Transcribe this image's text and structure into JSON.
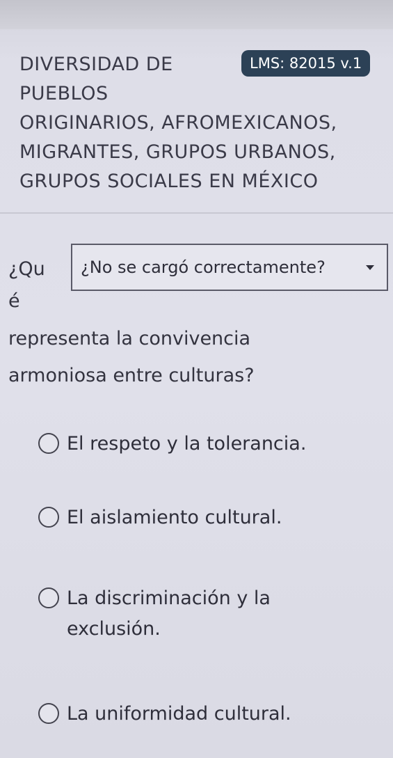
{
  "header": {
    "title": "DIVERSIDAD DE\nPUEBLOS\nORIGINARIOS, AFROMEXICANOS,\nMIGRANTES, GRUPOS URBANOS,\nGRUPOS SOCIALES EN MÉXICO",
    "badge": "LMS: 82015 v.1"
  },
  "question": {
    "fragment_1": "¿Qu",
    "fragment_2": "é",
    "dropdown_label": "¿No se cargó correctamente?",
    "text_rest": "representa la convivencia\narmoniosa entre culturas?"
  },
  "options": [
    {
      "label": "El respeto y la tolerancia."
    },
    {
      "label": "El aislamiento cultural."
    },
    {
      "label": "La discriminación y la\nexclusión."
    },
    {
      "label": "La uniformidad cultural."
    }
  ],
  "icons": {
    "caret": "caret-down-icon",
    "radio": "radio-empty-icon"
  },
  "colors": {
    "badge_background": "#2c4156",
    "page_background": "#dcdce8"
  }
}
